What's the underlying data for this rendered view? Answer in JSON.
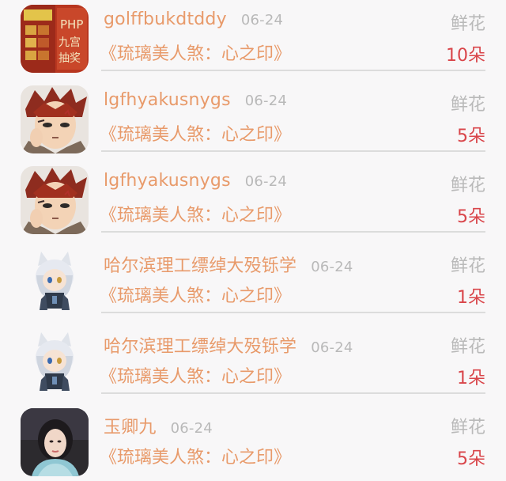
{
  "records": [
    {
      "user": "golffbukdtddy",
      "date": "06-24",
      "gift": "鲜花",
      "book": "《琉璃美人煞：心之印》",
      "count": "10朵",
      "avatar": "php-banner-avatar"
    },
    {
      "user": "lgfhyakusnygs",
      "date": "06-24",
      "gift": "鲜花",
      "book": "《琉璃美人煞：心之印》",
      "count": "5朵",
      "avatar": "anime-redhair-avatar"
    },
    {
      "user": "lgfhyakusnygs",
      "date": "06-24",
      "gift": "鲜花",
      "book": "《琉璃美人煞：心之印》",
      "count": "5朵",
      "avatar": "anime-redhair-avatar"
    },
    {
      "user": "哈尔滨理工缥绰大殁铄学",
      "date": "06-24",
      "gift": "鲜花",
      "book": "《琉璃美人煞：心之印》",
      "count": "1朵",
      "avatar": "chibi-foxgirl-avatar"
    },
    {
      "user": "哈尔滨理工缥绰大殁铄学",
      "date": "06-24",
      "gift": "鲜花",
      "book": "《琉璃美人煞：心之印》",
      "count": "1朵",
      "avatar": "chibi-foxgirl-avatar"
    },
    {
      "user": "玉卿九",
      "date": "06-24",
      "gift": "鲜花",
      "book": "《琉璃美人煞：心之印》",
      "count": "5朵",
      "avatar": "portrait-woman-avatar"
    }
  ]
}
